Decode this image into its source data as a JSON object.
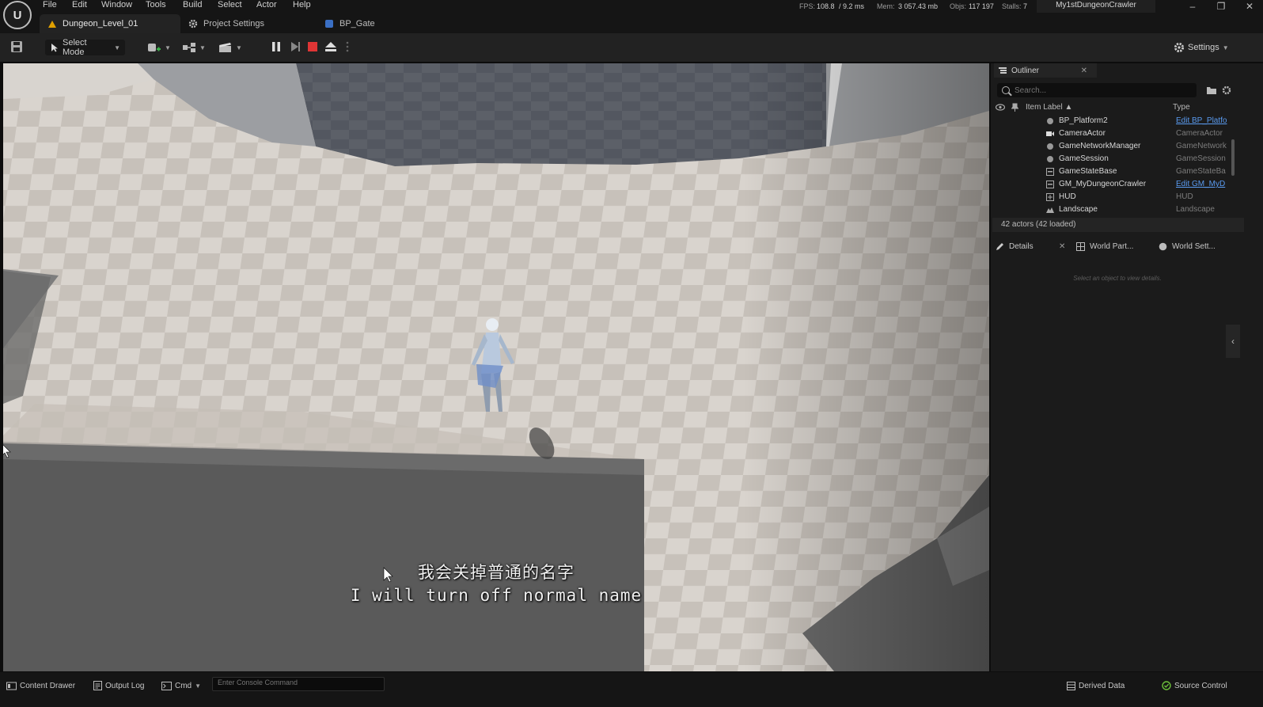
{
  "menubar": {
    "items": [
      "File",
      "Edit",
      "Window",
      "Tools",
      "Build",
      "Select",
      "Actor",
      "Help"
    ],
    "stats": {
      "fps_label": "FPS:",
      "fps": "108.8",
      "ms": "/ 9.2 ms",
      "mem_label": "Mem:",
      "mem": "3 057.43 mb",
      "objs_label": "Objs:",
      "objs": "117 197",
      "stalls_label": "Stalls:",
      "stalls": "7"
    },
    "project_name": "My1stDungeonCrawler"
  },
  "tabs": [
    {
      "label": "Dungeon_Level_01",
      "icon": "level-icon"
    },
    {
      "label": "Project Settings",
      "icon": "gear-icon"
    },
    {
      "label": "BP_Gate",
      "icon": "blueprint-icon"
    }
  ],
  "toolbar": {
    "select_mode": "Select Mode",
    "settings": "Settings"
  },
  "viewport": {
    "subtitle_cn": "我会关掉普通的名字",
    "subtitle_en": "I will turn off normal name"
  },
  "outliner": {
    "tab_label": "Outliner",
    "search_placeholder": "Search...",
    "col_label": "Item Label ▲",
    "col_type": "Type",
    "rows": [
      {
        "label": "BP_Platform2",
        "type": "Edit BP_Platfo",
        "link": true,
        "icon": "actor-icon"
      },
      {
        "label": "CameraActor",
        "type": "CameraActor",
        "link": false,
        "icon": "camera-icon"
      },
      {
        "label": "GameNetworkManager",
        "type": "GameNetwork",
        "link": false,
        "icon": "actor-icon"
      },
      {
        "label": "GameSession",
        "type": "GameSession",
        "link": false,
        "icon": "actor-icon"
      },
      {
        "label": "GameStateBase",
        "type": "GameStateBa",
        "link": false,
        "icon": "info-icon"
      },
      {
        "label": "GM_MyDungeonCrawler",
        "type": "Edit GM_MyD",
        "link": true,
        "icon": "info-icon"
      },
      {
        "label": "HUD",
        "type": "HUD",
        "link": false,
        "icon": "hud-icon"
      },
      {
        "label": "Landscape",
        "type": "Landscape",
        "link": false,
        "icon": "landscape-icon"
      }
    ],
    "count": "42 actors (42 loaded)"
  },
  "details": {
    "tabs": [
      "Details",
      "World Part...",
      "World Sett..."
    ],
    "empty_text": "Select an object to view details."
  },
  "statusbar": {
    "content_drawer": "Content Drawer",
    "output_log": "Output Log",
    "cmd": "Cmd",
    "console_placeholder": "Enter Console Command",
    "derived_data": "Derived Data",
    "source_control": "Source Control"
  },
  "colors": {
    "accent_link": "#5a9bf0",
    "stop_red": "#e03535",
    "panel_bg": "#1b1b1b"
  }
}
